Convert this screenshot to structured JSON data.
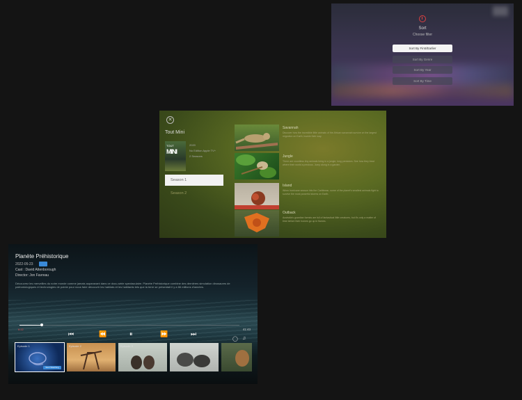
{
  "sort": {
    "title": "Sort",
    "subtitle": "Choose filter",
    "options": [
      "Sort By First/Earlier",
      "Sort By Genre",
      "Sort By Year",
      "Sort By Time"
    ],
    "active_index": 0
  },
  "mini": {
    "title": "Tout Mini",
    "poster_top": "TOUT",
    "poster_word": "MINI",
    "meta": [
      "2020",
      "No Edition Apple TV+",
      "2 Seasons"
    ],
    "seasons": [
      "Season 1",
      "Season 2"
    ],
    "episodes": [
      {
        "title": "Savannah",
        "desc": "Discover how the incredible little animals of the African savannah survive on the largest migration on Earth, buckle their way."
      },
      {
        "title": "Jungle",
        "desc": "There are countless tiny animals living in a jungle, long predators. See how they treat where their world a precious. Jump along in a garden."
      },
      {
        "title": "Island",
        "desc": "When hurricane season hits the Caribbean, some of the planet's smallest animals fight to survive the most powerful storms on Earth."
      },
      {
        "title": "Outback",
        "desc": "Australia's guardian forests are full of fantastical little creatures, but it's only a matter of time before their homes go up in flames."
      }
    ]
  },
  "player": {
    "title": "Planète Préhistorique",
    "date": "2022-05-23",
    "cast": "Cast : David Attenborough",
    "director": "Director: Jon Favreau",
    "description": "Découvrez les merveilles du notre monde comme jamais auparavant dans ce docu-série spectaculaire. Planète Préhistorique combine des dernières simulation dinosaures de paléontologiques et technologies de pointe pour nous faire découvrir les habitats et les habitants tels que la terre se présentait il y a 66 millions d'années.",
    "time_elapsed": "6:22",
    "time_total": "41:43",
    "watch_label": "Start Watching",
    "episodes": [
      "Episode 1",
      "Episode 2",
      "Episode 3",
      "",
      ""
    ],
    "icons": {
      "prev": "skip-previous-icon",
      "rewind": "rewind-icon",
      "pause": "pause-icon",
      "forward": "fast-forward-icon",
      "next": "skip-next-icon",
      "subtitles": "subtitles-icon",
      "audio": "music-note-icon"
    }
  }
}
